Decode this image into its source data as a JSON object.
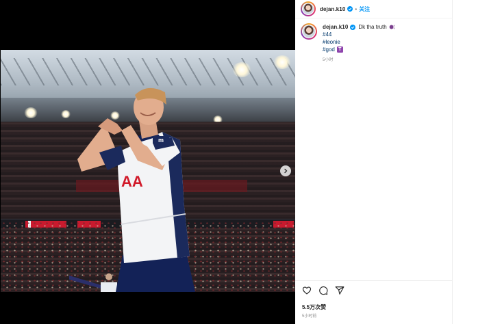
{
  "post": {
    "username": "dejan.k10",
    "separator": "•",
    "follow_label": "关注",
    "caption_text": "Dk tha truth",
    "hashtags": [
      "#44",
      "#leonie",
      "#god"
    ],
    "hashtag_suffix_glyph": "T",
    "caption_time": "5小时",
    "likes": "5.5万次赞",
    "post_time": "5小时前"
  },
  "photo": {
    "shirt_text": "AA",
    "sponsor_text": "m"
  },
  "colors": {
    "verified": "#0095f6",
    "follow": "#0095f6",
    "hashtag": "#00376b"
  },
  "icons": {
    "verified": "verified-badge-icon",
    "like": "heart-icon",
    "comment": "comment-icon",
    "share": "paper-plane-icon",
    "next": "chevron-right-icon"
  }
}
